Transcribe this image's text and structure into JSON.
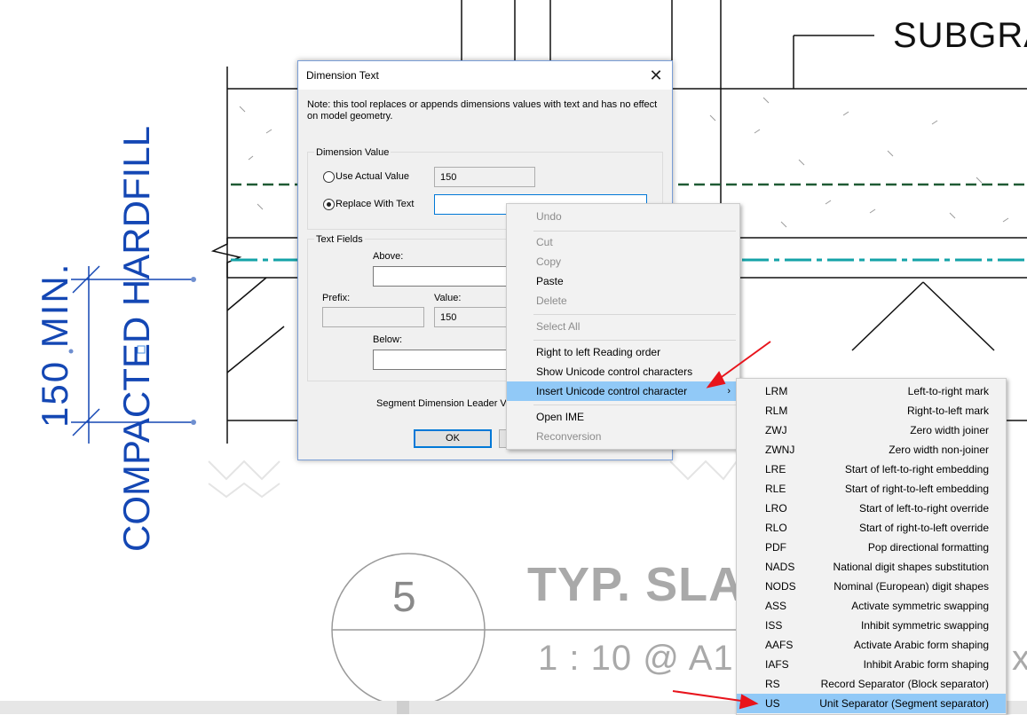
{
  "drawing": {
    "subgrade_label": "SUBGRA",
    "vertical_fill_label": "COMPACTED HARDFILL",
    "vertical_dim_label": "150  MIN.",
    "detail_number": "5",
    "detail_title": "TYP. SLA",
    "scale_text": "1 : 10 @ A1",
    "scale_trailing": "x",
    "line_colors": {
      "cad_line": "#111111",
      "dash_green": "#1f5a34",
      "dash_teal": "#14a3a8",
      "dim_blue": "#1447b4"
    }
  },
  "dialog": {
    "title": "Dimension Text",
    "close_glyph": "✕",
    "note": "Note: this tool replaces or appends dimensions values with text and has no effect on model geometry.",
    "dimension_value": {
      "group_label": "Dimension Value",
      "use_actual_label": "Use Actual Value",
      "actual_value": "150",
      "replace_label": "Replace With Text",
      "replace_value": "",
      "selected": "replace"
    },
    "text_fields": {
      "group_label": "Text Fields",
      "above_label": "Above:",
      "above_value": "",
      "prefix_label": "Prefix:",
      "prefix_value": "",
      "value_label": "Value:",
      "value_value": "150",
      "below_label": "Below:",
      "below_value": ""
    },
    "segment_label": "Segment Dimension Leader Vis",
    "ok_label": "OK"
  },
  "context_menu": {
    "items": [
      {
        "label": "Undo",
        "enabled": false
      },
      {
        "label": "Cut",
        "enabled": false
      },
      {
        "label": "Copy",
        "enabled": false
      },
      {
        "label": "Paste",
        "enabled": true
      },
      {
        "label": "Delete",
        "enabled": false
      },
      {
        "label": "Select All",
        "enabled": false
      },
      {
        "label": "Right to left Reading order",
        "enabled": true
      },
      {
        "label": "Show Unicode control characters",
        "enabled": true
      },
      {
        "label": "Insert Unicode control character",
        "enabled": true,
        "highlighted": true,
        "submenu": true
      },
      {
        "label": "Open IME",
        "enabled": true
      },
      {
        "label": "Reconversion",
        "enabled": false
      }
    ],
    "submenu_arrow": "›"
  },
  "unicode_submenu": {
    "items": [
      {
        "code": "LRM",
        "desc": "Left-to-right mark"
      },
      {
        "code": "RLM",
        "desc": "Right-to-left mark"
      },
      {
        "code": "ZWJ",
        "desc": "Zero width joiner"
      },
      {
        "code": "ZWNJ",
        "desc": "Zero width non-joiner"
      },
      {
        "code": "LRE",
        "desc": "Start of left-to-right embedding"
      },
      {
        "code": "RLE",
        "desc": "Start of right-to-left embedding"
      },
      {
        "code": "LRO",
        "desc": "Start of left-to-right override"
      },
      {
        "code": "RLO",
        "desc": "Start of right-to-left override"
      },
      {
        "code": "PDF",
        "desc": "Pop directional formatting"
      },
      {
        "code": "NADS",
        "desc": "National digit shapes substitution"
      },
      {
        "code": "NODS",
        "desc": "Nominal (European) digit shapes"
      },
      {
        "code": "ASS",
        "desc": "Activate symmetric swapping"
      },
      {
        "code": "ISS",
        "desc": "Inhibit symmetric swapping"
      },
      {
        "code": "AAFS",
        "desc": "Activate Arabic form shaping"
      },
      {
        "code": "IAFS",
        "desc": "Inhibit Arabic form shaping"
      },
      {
        "code": "RS",
        "desc": "Record Separator (Block separator)"
      },
      {
        "code": "US",
        "desc": "Unit Separator (Segment separator)",
        "highlighted": true
      }
    ]
  },
  "annotations": {
    "arrow_color": "#e8141c"
  }
}
